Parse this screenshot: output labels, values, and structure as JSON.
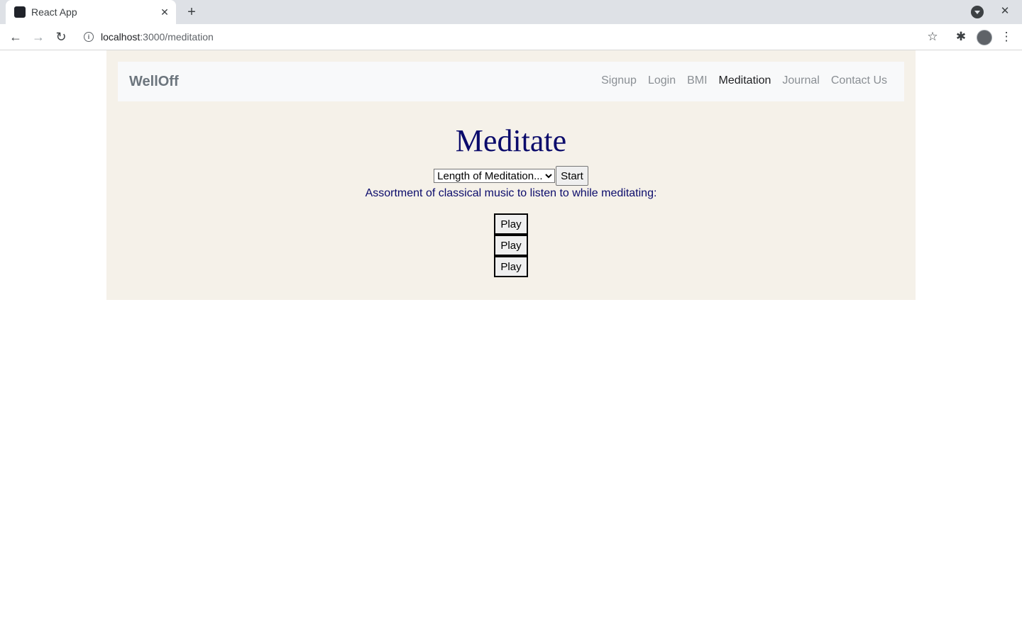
{
  "browser": {
    "tab_title": "React App",
    "tab_close": "✕",
    "new_tab": "+",
    "url_host": "localhost",
    "url_path": ":3000/meditation",
    "window_close": "✕"
  },
  "navbar": {
    "brand": "WellOff",
    "links": [
      "Signup",
      "Login",
      "BMI",
      "Meditation",
      "Journal",
      "Contact Us"
    ],
    "active": "Meditation"
  },
  "main": {
    "heading": "Meditate",
    "select_value": "Length of Meditation...",
    "start_label": "Start",
    "subtitle": "Assortment of classical music to listen to while meditating:",
    "play_buttons": [
      "Play",
      "Play",
      "Play"
    ]
  },
  "colors": {
    "page_bg": "#f5f1e9",
    "navbar_bg": "#f8f9fa",
    "heading": "#0b0b6b"
  }
}
